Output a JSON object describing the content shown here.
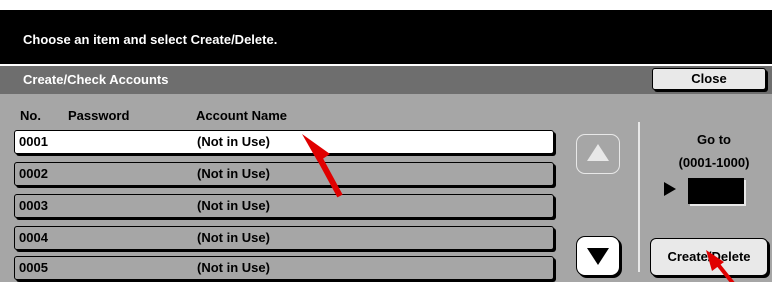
{
  "message": "Choose an item and select Create/Delete.",
  "header": {
    "title": "Create/Check Accounts",
    "close_label": "Close"
  },
  "columns": {
    "no": "No.",
    "password": "Password",
    "account_name": "Account Name"
  },
  "rows": [
    {
      "no": "0001",
      "name": "(Not in Use)",
      "selected": true
    },
    {
      "no": "0002",
      "name": "(Not in Use)",
      "selected": false
    },
    {
      "no": "0003",
      "name": "(Not in Use)",
      "selected": false
    },
    {
      "no": "0004",
      "name": "(Not in Use)",
      "selected": false
    },
    {
      "no": "0005",
      "name": "(Not in Use)",
      "selected": false
    }
  ],
  "goto": {
    "label": "Go to",
    "range": "(0001-1000)",
    "value": ""
  },
  "create_delete_label": "Create/Delete",
  "icons": {
    "scroll_up": "triangle-up-icon",
    "scroll_down": "triangle-down-icon",
    "goto_pointer": "play-icon"
  },
  "colors": {
    "message_bar": "#000000",
    "title_bar": "#6e6e6e",
    "panel": "#a6a6a6",
    "selected_row": "#ffffff",
    "annotation_arrow": "#e00000"
  }
}
